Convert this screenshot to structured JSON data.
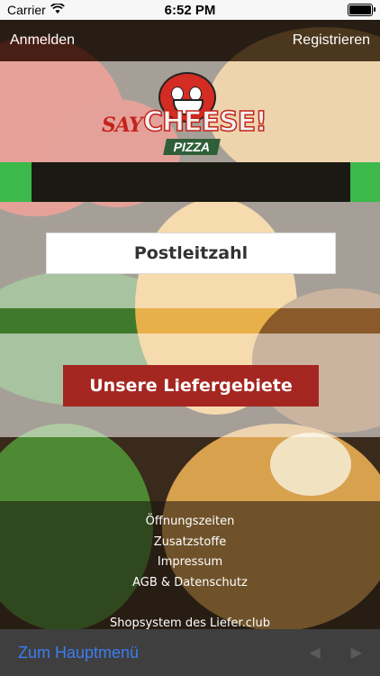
{
  "status": {
    "carrier": "Carrier",
    "time": "6:52 PM"
  },
  "topbar": {
    "login": "Anmelden",
    "register": "Registrieren"
  },
  "logo": {
    "say": "SAY",
    "cheese": "CHEESE!",
    "pizza": "PIZZA"
  },
  "form": {
    "postal_code": "Postleitzahl",
    "delivery_areas_button": "Unsere Liefergebiete"
  },
  "footer": {
    "links": [
      "Öffnungszeiten",
      "Zusatzstoffe",
      "Impressum",
      "AGB & Datenschutz"
    ],
    "shop": "Shopsystem des Liefer.club"
  },
  "bottombar": {
    "main_menu": "Zum Hauptmenü",
    "back_icon": "back-arrow-icon",
    "forward_icon": "forward-arrow-icon"
  },
  "colors": {
    "accent_green": "#3cb94a",
    "button_red": "#a52621",
    "link_blue": "#3a7ef0"
  }
}
